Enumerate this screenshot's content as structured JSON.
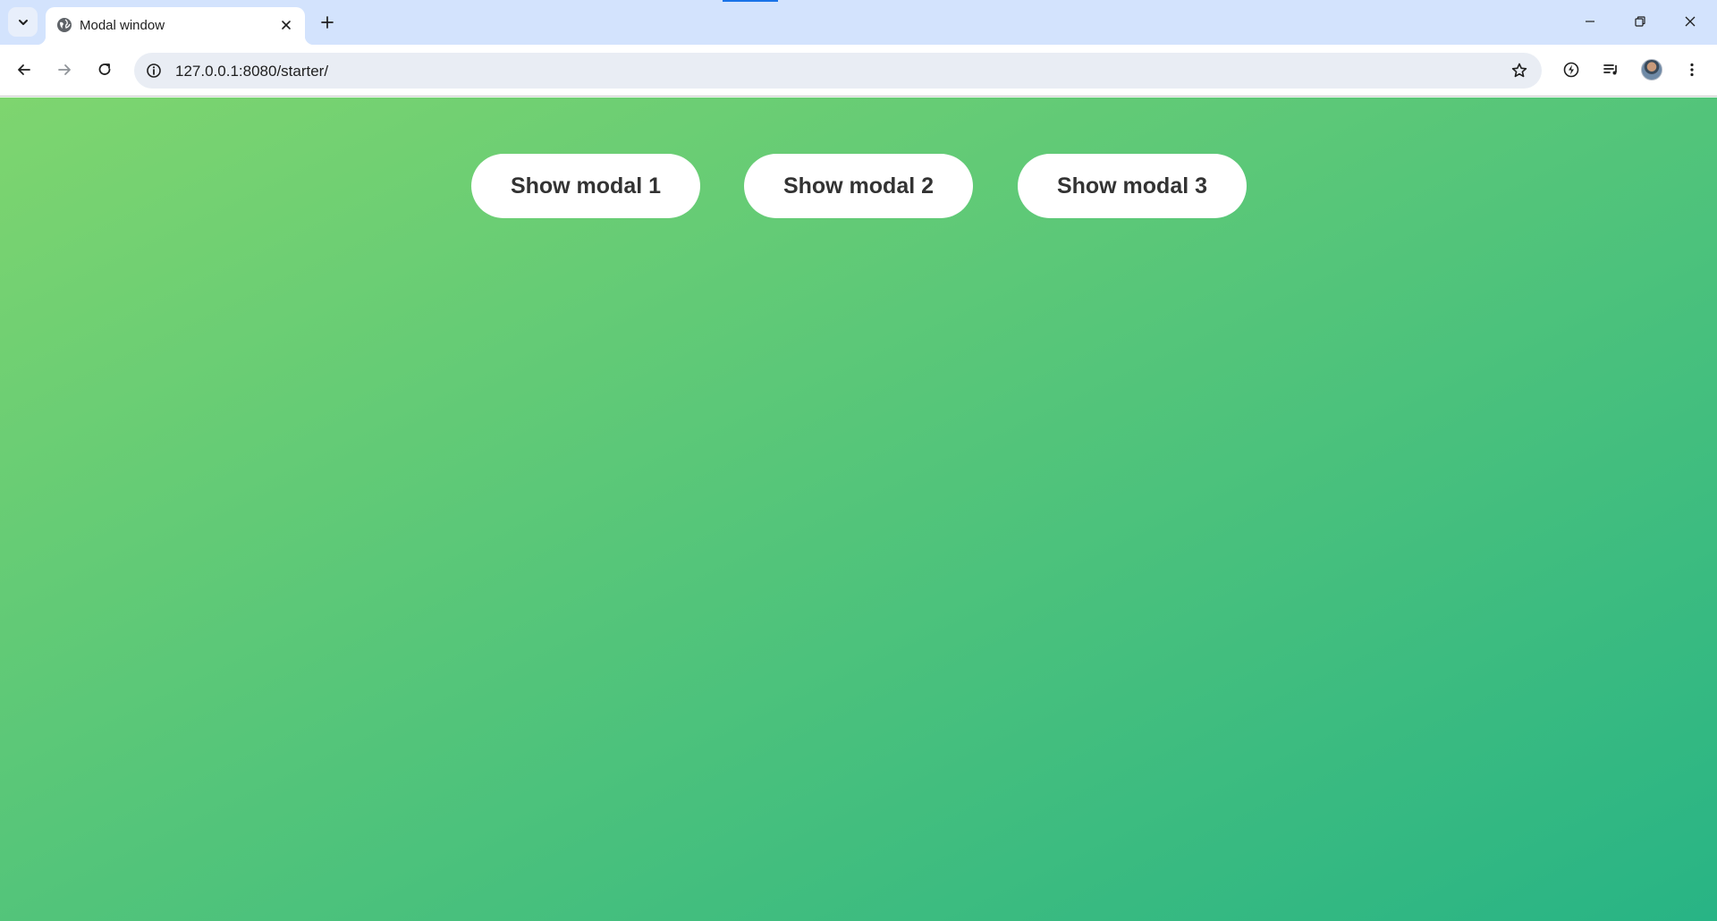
{
  "browser": {
    "tab": {
      "title": "Modal window",
      "favicon": "globe-icon"
    },
    "url": "127.0.0.1:8080/starter/"
  },
  "page": {
    "background_gradient": [
      "#7ed56f",
      "#28b485"
    ],
    "buttons": [
      {
        "label": "Show modal 1"
      },
      {
        "label": "Show modal 2"
      },
      {
        "label": "Show modal 3"
      }
    ]
  }
}
